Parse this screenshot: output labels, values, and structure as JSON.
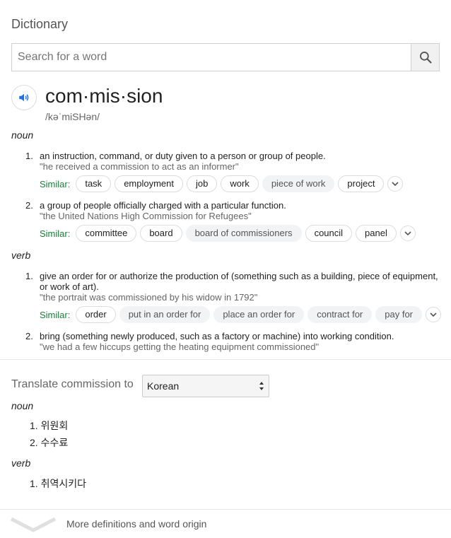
{
  "header": {
    "title": "Dictionary"
  },
  "search": {
    "placeholder": "Search for a word",
    "value": ""
  },
  "entry": {
    "word": "com·mis·sion",
    "phonetic": "/kəˈmiSHən/"
  },
  "similar_label": "Similar:",
  "noun": {
    "label": "noun",
    "senses": [
      {
        "num": "1.",
        "definition": "an instruction, command, or duty given to a person or group of people.",
        "example": "\"he received a commission to act as an informer\"",
        "similar": [
          {
            "text": "task",
            "style": "outlined"
          },
          {
            "text": "employment",
            "style": "outlined"
          },
          {
            "text": "job",
            "style": "outlined"
          },
          {
            "text": "work",
            "style": "outlined"
          },
          {
            "text": "piece of work",
            "style": "filled"
          },
          {
            "text": "project",
            "style": "outlined"
          }
        ]
      },
      {
        "num": "2.",
        "definition": "a group of people officially charged with a particular function.",
        "example": "\"the United Nations High Commission for Refugees\"",
        "similar": [
          {
            "text": "committee",
            "style": "outlined"
          },
          {
            "text": "board",
            "style": "outlined"
          },
          {
            "text": "board of commissioners",
            "style": "filled"
          },
          {
            "text": "council",
            "style": "outlined"
          },
          {
            "text": "panel",
            "style": "outlined"
          }
        ]
      }
    ]
  },
  "verb": {
    "label": "verb",
    "senses": [
      {
        "num": "1.",
        "definition": "give an order for or authorize the production of (something such as a building, piece of equipment, or work of art).",
        "example": "\"the portrait was commissioned by his widow in 1792\"",
        "similar": [
          {
            "text": "order",
            "style": "outlined"
          },
          {
            "text": "put in an order for",
            "style": "filled"
          },
          {
            "text": "place an order for",
            "style": "filled"
          },
          {
            "text": "contract for",
            "style": "filled"
          },
          {
            "text": "pay for",
            "style": "filled"
          }
        ]
      },
      {
        "num": "2.",
        "definition": "bring (something newly produced, such as a factory or machine) into working condition.",
        "example": "\"we had a few hiccups getting the heating equipment commissioned\""
      }
    ]
  },
  "translate": {
    "label": "Translate commission to",
    "language": "Korean",
    "noun_label": "noun",
    "noun_items": [
      "1. 위원회",
      "2. 수수료"
    ],
    "verb_label": "verb",
    "verb_items": [
      "1. 취역시키다"
    ]
  },
  "footer": {
    "more_link": "More definitions and word origin"
  },
  "colors": {
    "similar_label": "#188038",
    "speaker_icon": "#1a73e8"
  },
  "icons": {
    "search": "search-icon",
    "speaker": "speaker-icon",
    "expand": "chevron-down-icon"
  }
}
